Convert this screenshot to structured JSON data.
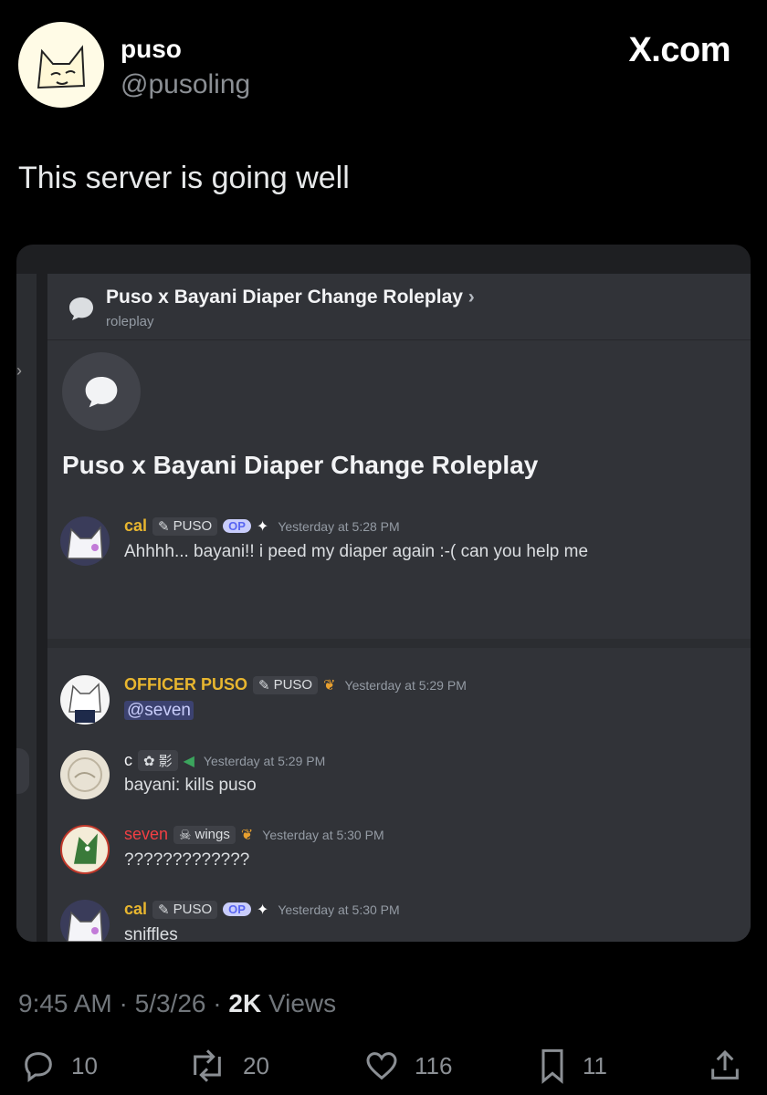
{
  "author": {
    "name": "puso",
    "handle": "@pusoling"
  },
  "brand": "X.com",
  "tweet_text": "This server is going well",
  "discord": {
    "header_title": "Puso x Bayani Diaper Change Roleplay",
    "header_chevron": "›",
    "header_sub": "roleplay",
    "thread_title": "Puso x Bayani Diaper Change Roleplay",
    "messages": [
      {
        "user": "cal",
        "user_color": "#e8b62f",
        "tag": "PUSO",
        "op": "OP",
        "time": "Yesterday at 5:28 PM",
        "text": "Ahhhh... bayani!! i peed my diaper again :-( can you help me"
      },
      {
        "user": "OFFICER PUSO",
        "user_color": "#e8b62f",
        "tag": "PUSO",
        "time": "Yesterday at 5:29 PM",
        "text": "@seven"
      },
      {
        "user": "c",
        "user_color": "#f2f3f5",
        "tag": "影",
        "time": "Yesterday at 5:29 PM",
        "text": "bayani: kills puso"
      },
      {
        "user": "seven",
        "user_color": "#f23f43",
        "tag": "wings",
        "time": "Yesterday at 5:30 PM",
        "text": "?????????????"
      },
      {
        "user": "cal",
        "user_color": "#e8b62f",
        "tag": "PUSO",
        "op": "OP",
        "time": "Yesterday at 5:30 PM",
        "text": "sniffles"
      }
    ]
  },
  "meta": {
    "time": "9:45 AM",
    "date": "5/3/26",
    "views_count": "2K",
    "views_label": "Views"
  },
  "actions": {
    "replies": "10",
    "reposts": "20",
    "likes": "116",
    "bookmarks": "11"
  }
}
